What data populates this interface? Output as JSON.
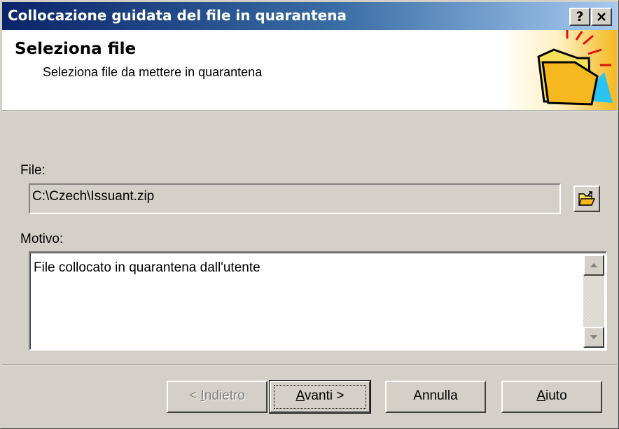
{
  "window": {
    "title": "Collocazione guidata del file in quarantena",
    "help_button": "?",
    "close_button": "✕"
  },
  "header": {
    "title": "Seleziona file",
    "subtitle": "Seleziona file da mettere in quarantena",
    "icon": "folder-icon"
  },
  "form": {
    "file_label": "File:",
    "file_value": "C:\\Czech\\Issuant.zip",
    "browse_icon": "open-folder-icon",
    "reason_label": "Motivo:",
    "reason_value": "File collocato in quarantena dall'utente"
  },
  "buttons": {
    "back": {
      "prefix": "< ",
      "mnemonic": "I",
      "rest": "ndietro",
      "enabled": false
    },
    "next": {
      "mnemonic": "A",
      "rest": "vanti >"
    },
    "cancel": "Annulla",
    "help": {
      "mnemonic": "A",
      "rest": "iuto"
    }
  },
  "colors": {
    "titlebar_start": "#0a246a",
    "titlebar_end": "#a6caf0",
    "face": "#d4d0c8"
  }
}
